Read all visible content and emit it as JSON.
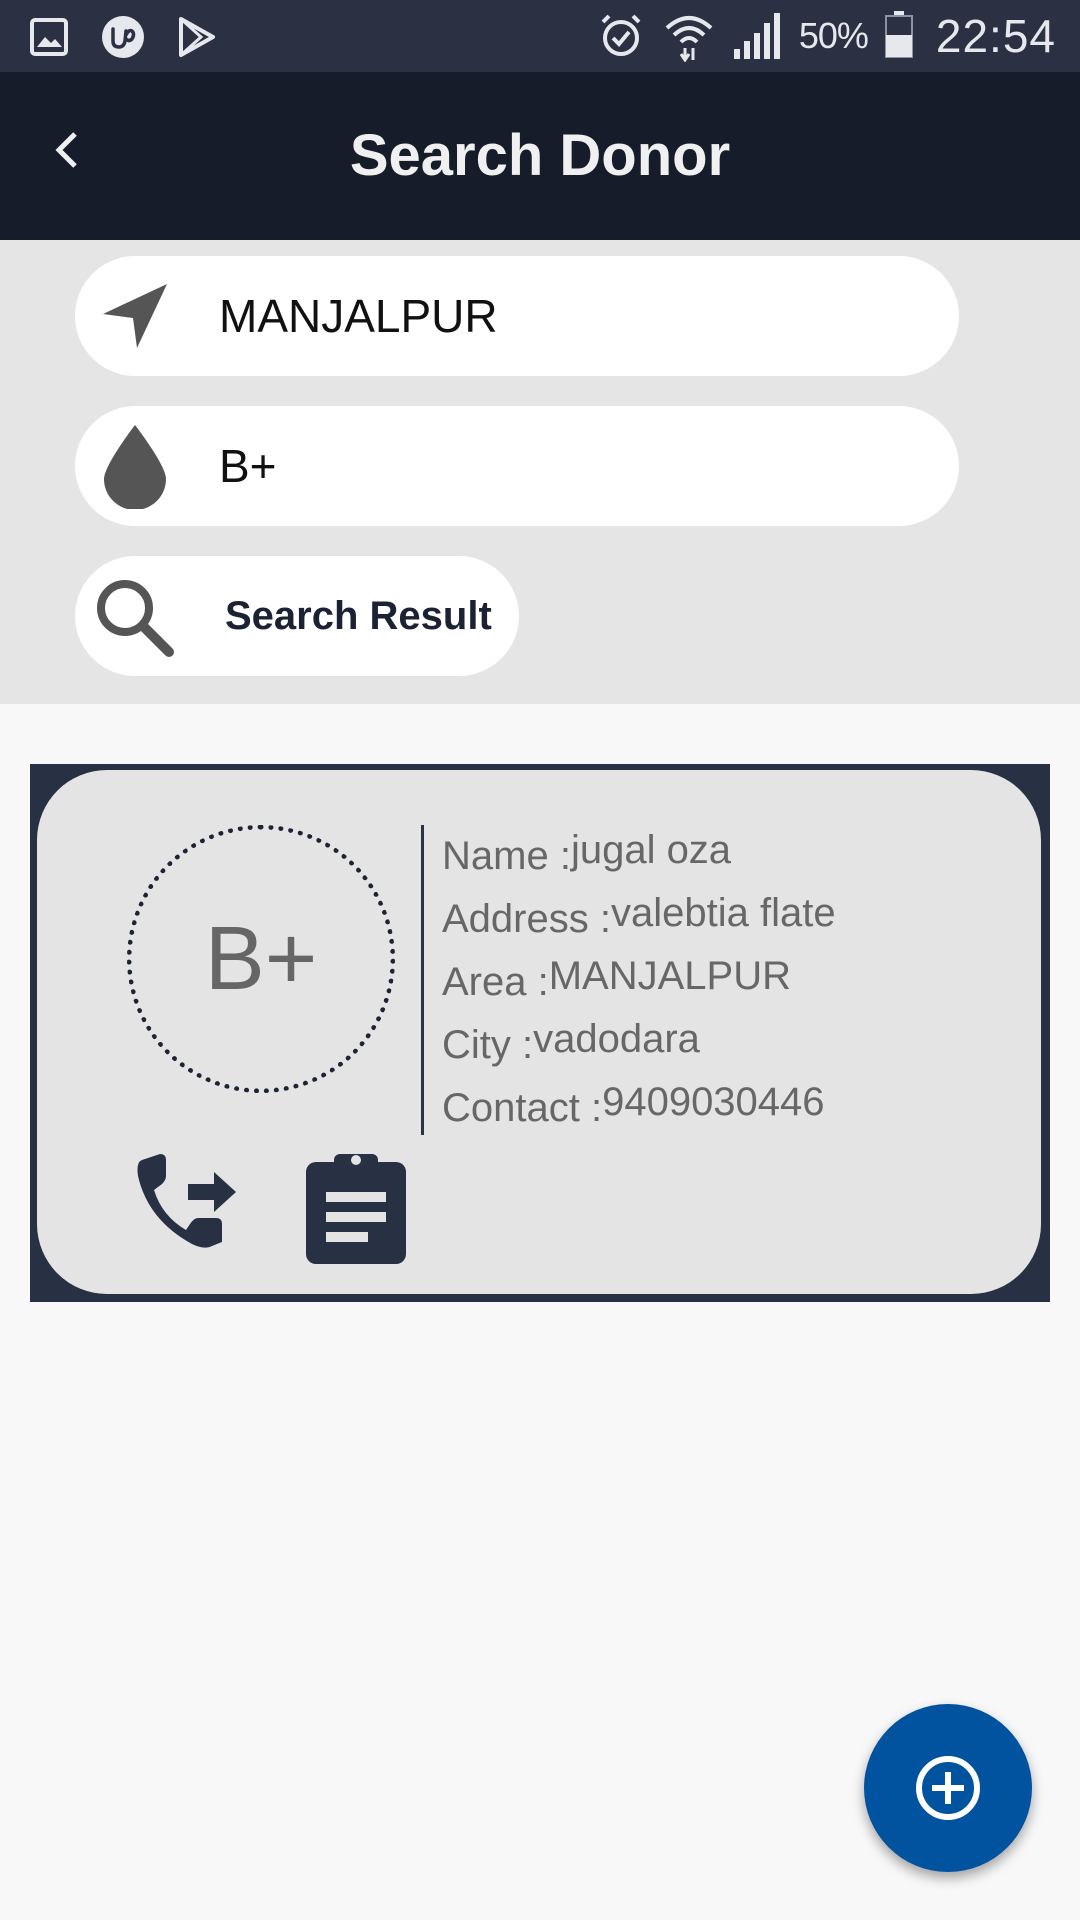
{
  "status_bar": {
    "left_icons": [
      "gallery-icon",
      "upwork-icon",
      "play-store-icon"
    ],
    "battery": "50%",
    "time": "22:54"
  },
  "app_bar": {
    "title": "Search Donor",
    "back_icon": "chevron-left-icon"
  },
  "search": {
    "location_value": "MANJALPUR",
    "blood_group_value": "B+",
    "search_button_label": "Search Result"
  },
  "donor_card": {
    "blood_group": "B+",
    "name_label": "Name :",
    "name": "jugal oza",
    "address_label": "Address :",
    "address": "valebtia flate",
    "area_label": "Area :",
    "area": "MANJALPUR",
    "city_label": "City :",
    "city": "vadodara",
    "contact_label": "Contact :",
    "contact": "9409030446"
  },
  "colors": {
    "status_bar": "#2b3142",
    "app_bar": "#171c2b",
    "panel": "#e5e5e5",
    "card_frame": "#283043",
    "fab": "#01539f"
  }
}
